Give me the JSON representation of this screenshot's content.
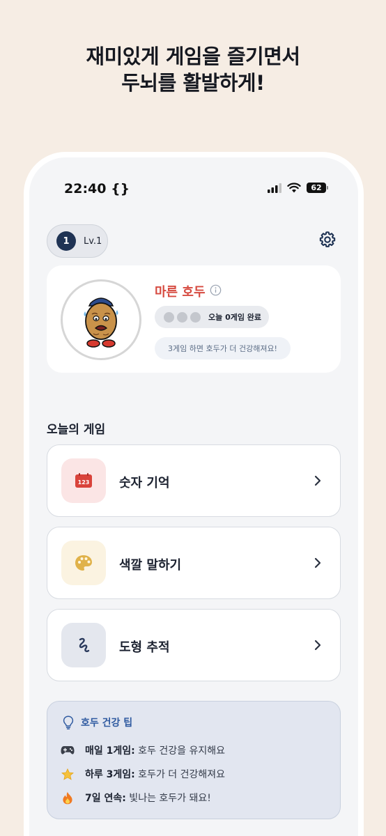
{
  "promo": {
    "line1": "재미있게 게임을 즐기면서",
    "line2": "두뇌를 활발하게!"
  },
  "status_bar": {
    "time": "22:40 {}",
    "battery": "62",
    "icons": [
      "signal-icon",
      "wifi-icon",
      "battery-icon"
    ]
  },
  "level": {
    "number": "1",
    "label": "Lv.1"
  },
  "settings_icon": "gear-icon",
  "profile": {
    "pet_name": "마른 호두",
    "completed_dots": 0,
    "total_dots": 3,
    "progress_text": "오늘 0게임 완료",
    "hint": "3게임 하면 호두가 더 건강해져요!"
  },
  "games_section": {
    "title": "오늘의 게임",
    "items": [
      {
        "label": "숫자 기억",
        "icon": "number-calendar-icon",
        "icon_text": "123",
        "icon_bg": "#fbe5e5",
        "accent": "#d9433b"
      },
      {
        "label": "색깔 말하기",
        "icon": "palette-icon",
        "icon_bg": "#fbf3e1",
        "accent": "#e0b24a"
      },
      {
        "label": "도형 추적",
        "icon": "squiggle-icon",
        "icon_bg": "#e4e7ee",
        "accent": "#2a3a5c"
      }
    ]
  },
  "tips": {
    "title": "호두 건강 팁",
    "items": [
      {
        "emoji": "🎮",
        "strong": "매일 1게임:",
        "text": " 호두 건강을 유지해요"
      },
      {
        "emoji": "⭐",
        "strong": "하루 3게임:",
        "text": " 호두가 더 건강해져요"
      },
      {
        "emoji": "🔥",
        "strong": "7일 연속:",
        "text": " 빛나는 호두가 돼요!"
      }
    ]
  }
}
